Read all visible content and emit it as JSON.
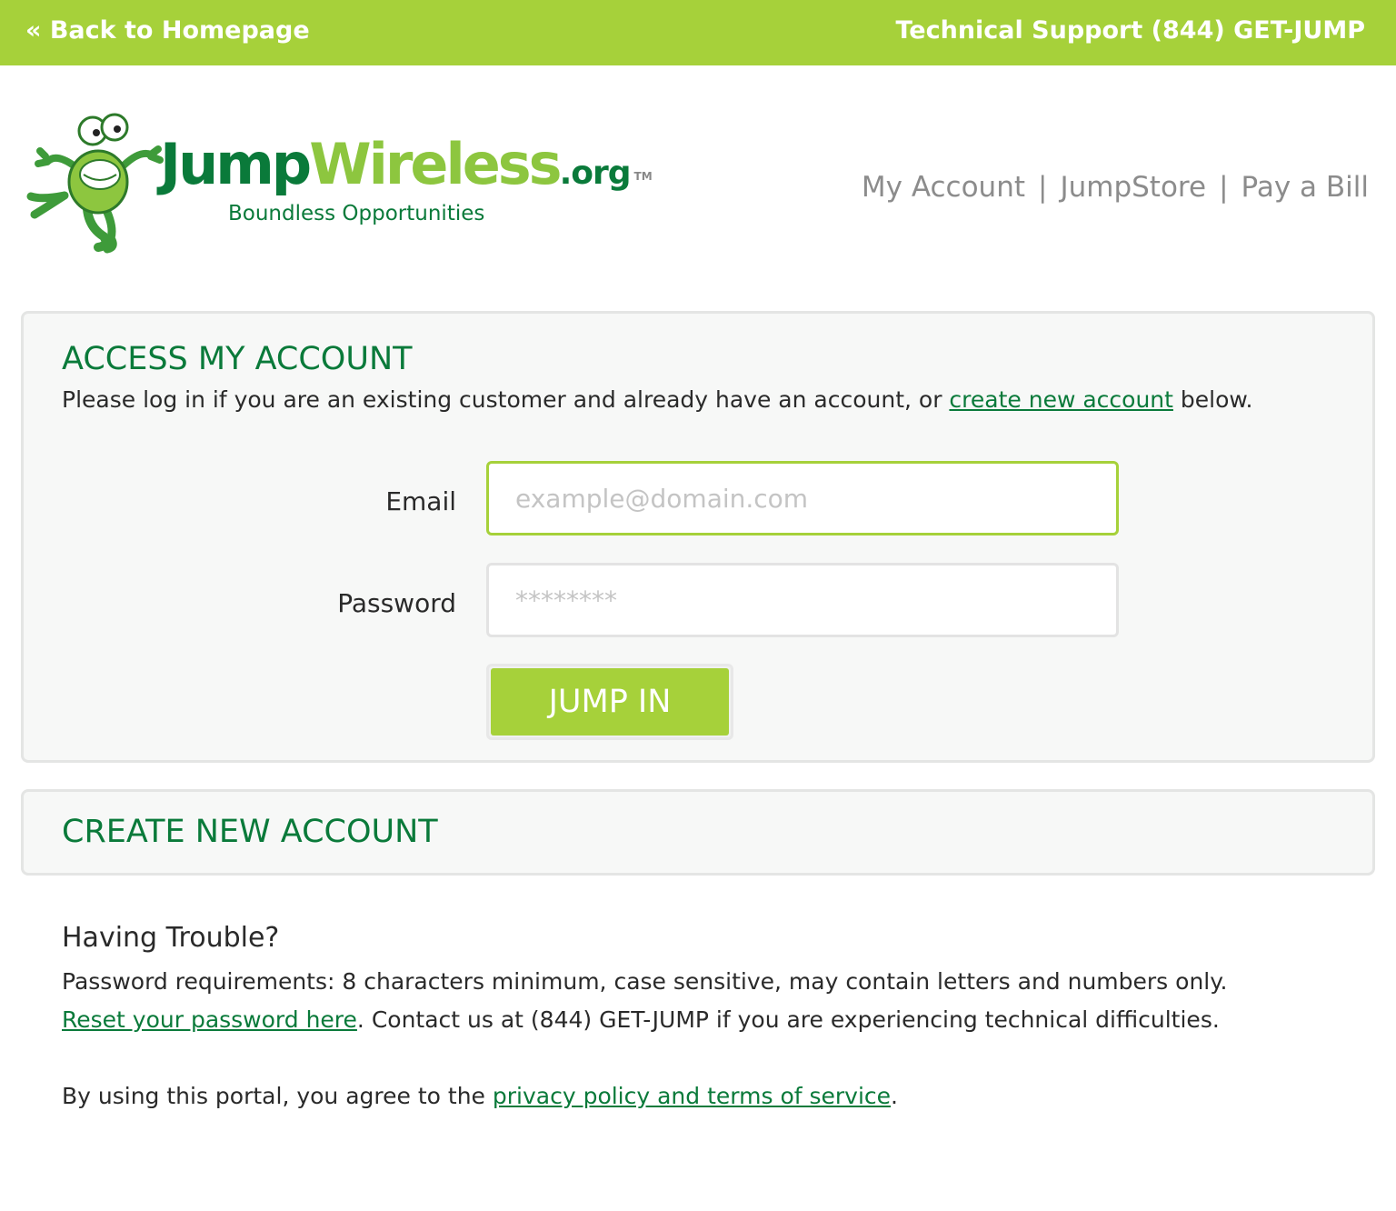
{
  "topbar": {
    "back_label": "« Back to Homepage",
    "support_label": "Technical Support (844) GET-JUMP"
  },
  "logo": {
    "jump": "Jump",
    "wireless": "Wireless",
    "org": ".org",
    "tm": "TM",
    "tagline": "Boundless Opportunities"
  },
  "nav": {
    "items": [
      {
        "label": "My Account"
      },
      {
        "label": "JumpStore"
      },
      {
        "label": "Pay a Bill"
      }
    ],
    "separator": "|"
  },
  "access": {
    "heading": "ACCESS MY ACCOUNT",
    "intro_before": "Please log in if you are an existing customer and already have an account, or ",
    "intro_link": "create new account",
    "intro_after": " below.",
    "email_label": "Email",
    "email_placeholder": "example@domain.com",
    "password_label": "Password",
    "password_placeholder": "********",
    "submit_label": "JUMP IN"
  },
  "create": {
    "heading": "CREATE NEW ACCOUNT"
  },
  "trouble": {
    "heading": "Having Trouble?",
    "requirements": "Password requirements: 8 characters minimum, case sensitive, may contain letters and numbers only.",
    "reset_link": "Reset your password here",
    "contact_text": ". Contact us at (844) GET-JUMP if you are experiencing technical difficulties.",
    "agree_before": "By using this portal, you agree to the ",
    "agree_link": "privacy policy and terms of service",
    "agree_after": "."
  },
  "colors": {
    "brand_green": "#a6d13a",
    "dark_green": "#0a7a3a",
    "panel_bg": "#f7f8f7"
  }
}
